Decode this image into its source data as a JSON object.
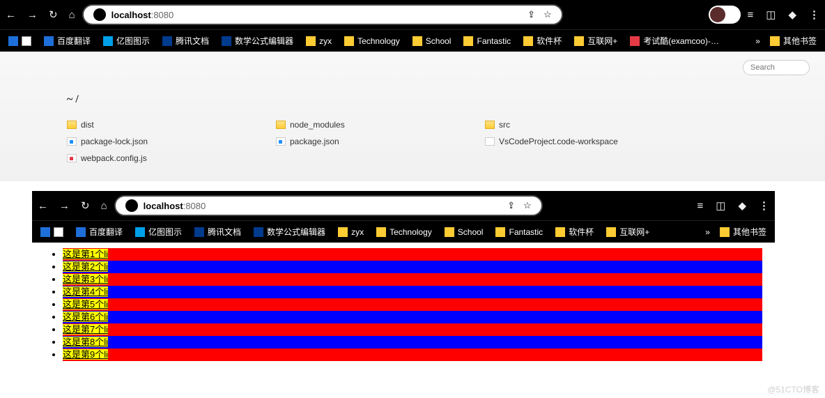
{
  "chrome": {
    "url_host": "localhost",
    "url_port": ":8080",
    "bookmarks": [
      {
        "label": "百度翻译",
        "icon": "blue"
      },
      {
        "label": "亿图图示",
        "icon": "aqua"
      },
      {
        "label": "腾讯文档",
        "icon": "navy"
      },
      {
        "label": "数学公式编辑器",
        "icon": "navy"
      },
      {
        "label": "zyx",
        "icon": "folder"
      },
      {
        "label": "Technology",
        "icon": "folder"
      },
      {
        "label": "School",
        "icon": "folder"
      },
      {
        "label": "Fantastic",
        "icon": "folder"
      },
      {
        "label": "软件杯",
        "icon": "folder"
      },
      {
        "label": "互联网+",
        "icon": "folder"
      },
      {
        "label": "考试酷(examcoo)-…",
        "icon": "red"
      }
    ],
    "bookmarks_short": [
      {
        "label": "百度翻译",
        "icon": "blue"
      },
      {
        "label": "亿图图示",
        "icon": "aqua"
      },
      {
        "label": "腾讯文档",
        "icon": "navy"
      },
      {
        "label": "数学公式编辑器",
        "icon": "navy"
      },
      {
        "label": "zyx",
        "icon": "folder"
      },
      {
        "label": "Technology",
        "icon": "folder"
      },
      {
        "label": "School",
        "icon": "folder"
      },
      {
        "label": "Fantastic",
        "icon": "folder"
      },
      {
        "label": "软件杯",
        "icon": "folder"
      },
      {
        "label": "互联网+",
        "icon": "folder"
      }
    ],
    "other_bm": "其他书签",
    "more": "»"
  },
  "page1": {
    "search_placeholder": "Search",
    "breadcrumb": "~ /",
    "files": [
      {
        "name": "dist",
        "type": "dir"
      },
      {
        "name": "node_modules",
        "type": "dir"
      },
      {
        "name": "src",
        "type": "dir"
      },
      {
        "name": "package-lock.json",
        "type": "json"
      },
      {
        "name": "package.json",
        "type": "json"
      },
      {
        "name": "VsCodeProject.code-workspace",
        "type": "file"
      },
      {
        "name": "webpack.config.js",
        "type": "js"
      }
    ]
  },
  "page2": {
    "items": [
      "这是第1个li",
      "这是第2个li",
      "这是第3个li",
      "这是第4个li",
      "这是第5个li",
      "这是第6个li",
      "这是第7个li",
      "这是第8个li",
      "这是第9个li"
    ]
  },
  "watermark": "@51CTO博客"
}
